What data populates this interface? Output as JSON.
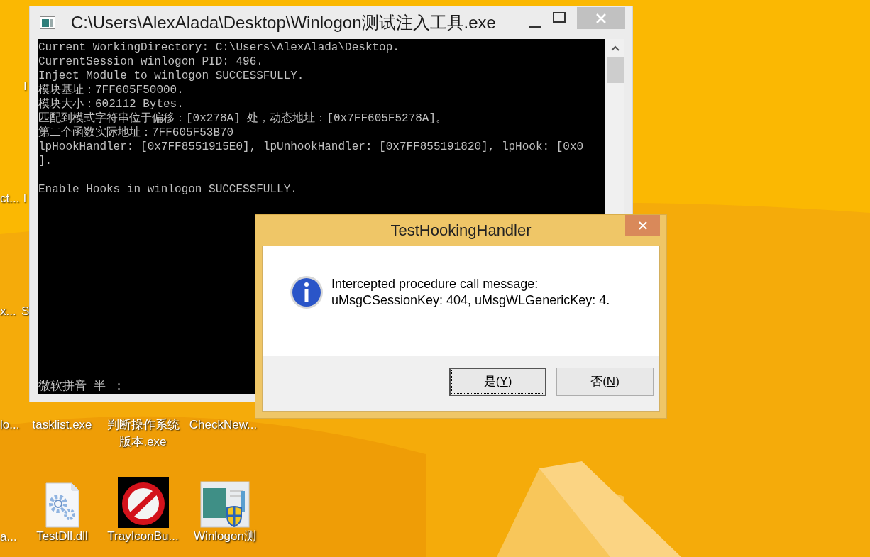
{
  "console_window": {
    "title": "C:\\Users\\AlexAlada\\Desktop\\Winlogon测试注入工具.exe",
    "output_blocks": [
      [
        "Current WorkingDirectory: C:\\Users\\AlexAlada\\Desktop.",
        "CurrentSession winlogon PID: 496.",
        "Inject Module to winlogon SUCCESSFULLY.",
        "模块基址：7FF605F50000.",
        "模块大小：602112 Bytes.",
        "匹配到模式字符串位于偏移：[0x278A] 处，动态地址：[0x7FF605F5278A]。",
        "第二个函数实际地址：7FF605F53B70",
        "lpHookHandler: [0x7FF8551915E0], lpUnhookHandler: [0x7FF855191820], lpHook: [0x0",
        "]."
      ],
      [
        "Enable Hooks in winlogon SUCCESSFULLY."
      ]
    ],
    "ime_status": "微软拼音 半 ："
  },
  "dialog": {
    "title": "TestHookingHandler",
    "message_lines": [
      "Intercepted procedure call message:",
      "uMsgCSessionKey: 404, uMsgWLGenericKey: 4."
    ],
    "buttons": [
      {
        "before": "是(",
        "mnemonic": "Y",
        "after": ")",
        "default": true
      },
      {
        "before": "否(",
        "mnemonic": "N",
        "after": ")",
        "default": false
      }
    ]
  },
  "desktop_icons": [
    {
      "label": "ct...",
      "kind": "label"
    },
    {
      "label": "x...",
      "kind": "label"
    },
    {
      "label": "lo...",
      "kind": "label"
    },
    {
      "label": "a...",
      "kind": "label"
    },
    {
      "label": "I",
      "kind": "label"
    },
    {
      "label": "l",
      "kind": "label"
    },
    {
      "label": "S",
      "kind": "label"
    },
    {
      "label": "tasklist.exe",
      "kind": "label"
    },
    {
      "label": "TestDll.dll",
      "kind": "dll"
    },
    {
      "label": "判断操作系统版本.exe",
      "kind": "label"
    },
    {
      "label": "TrayIconBu...",
      "kind": "tray"
    },
    {
      "label": "CheckNew...",
      "kind": "label"
    },
    {
      "label": "Winlogon测",
      "kind": "installer"
    }
  ]
}
